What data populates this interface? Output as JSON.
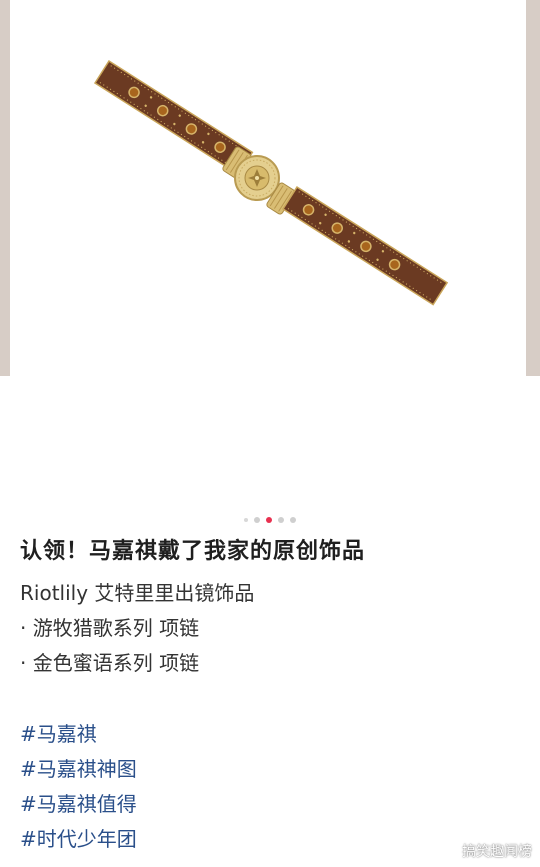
{
  "carousel": {
    "image_alt": "choker necklace product photo",
    "dot_count": 5,
    "active_index": 2,
    "colors": {
      "frame": "#d7cdc6",
      "leather": "#6b3a22",
      "gold": "#c9a55a",
      "stone": "#a8651d",
      "active_dot": "#e8304f"
    }
  },
  "post": {
    "title": "认领！马嘉祺戴了我家的原创饰品",
    "lines": [
      "Riotlily 艾特里里出镜饰品",
      "· 游牧猎歌系列 项链",
      "· 金色蜜语系列 项链"
    ],
    "hashtags": [
      "#马嘉祺",
      "#马嘉祺神图",
      "#马嘉祺值得",
      "#时代少年团"
    ],
    "hashtag_color": "#2a4f8a"
  },
  "watermark": {
    "text": "搞笑趣闻榜",
    "icon": "weibo-icon"
  }
}
